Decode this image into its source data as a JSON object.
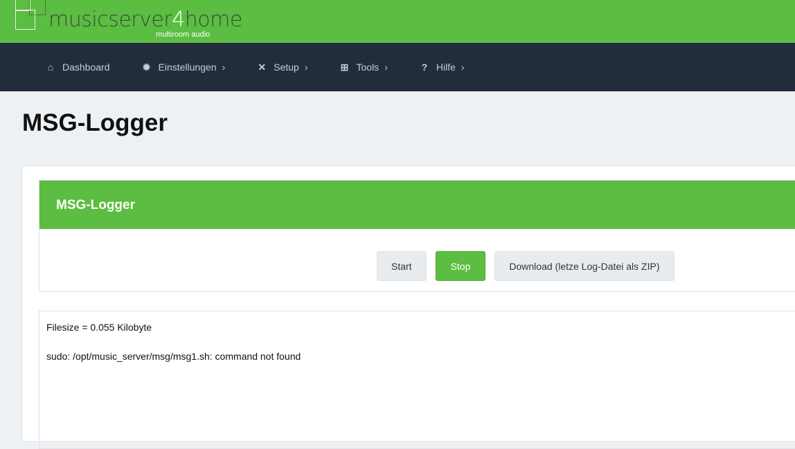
{
  "logo": {
    "name_a": "musicserver",
    "name_b": "4",
    "name_c": "home",
    "tagline": "multiroom audio"
  },
  "nav": [
    {
      "icon": "home-icon",
      "glyph": "⌂",
      "label": "Dashboard",
      "chevron": ""
    },
    {
      "icon": "gear-icon",
      "glyph": "✹",
      "label": "Einstellungen",
      "chevron": "›"
    },
    {
      "icon": "tools-icon",
      "glyph": "✕",
      "label": "Setup",
      "chevron": "›"
    },
    {
      "icon": "plus-square-icon",
      "glyph": "⊞",
      "label": "Tools",
      "chevron": "›"
    },
    {
      "icon": "question-icon",
      "glyph": "?",
      "label": "Hilfe",
      "chevron": "›"
    }
  ],
  "page_title": "MSG-Logger",
  "panel": {
    "title": "MSG-Logger",
    "start": "Start",
    "stop": "Stop",
    "download": "Download (letze Log-Datei als ZIP)"
  },
  "log": {
    "line1": "Filesize = 0.055 Kilobyte",
    "line2": "sudo: /opt/music_server/msg/msg1.sh: command not found"
  }
}
